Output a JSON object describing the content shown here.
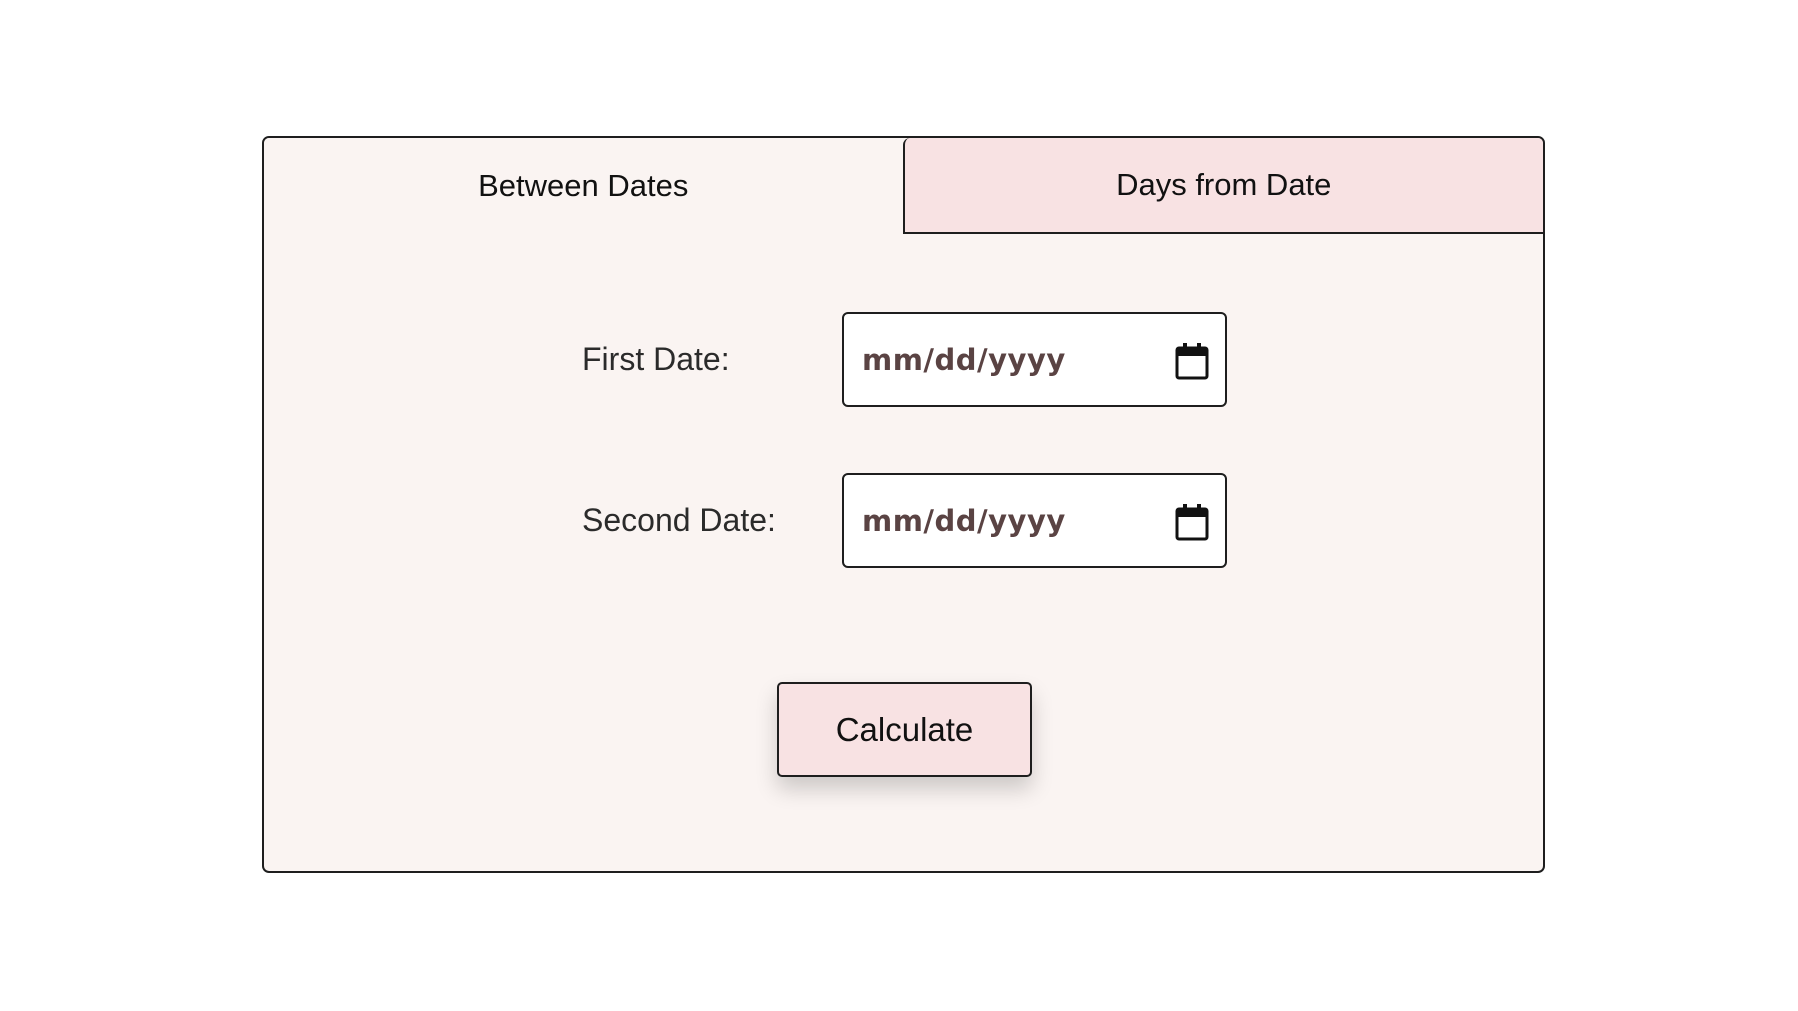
{
  "tabs": [
    {
      "label": "Between Dates",
      "active": true
    },
    {
      "label": "Days from Date",
      "active": false
    }
  ],
  "form": {
    "first_date": {
      "label": "First Date:",
      "placeholder": "mm/dd/yyyy",
      "icon": "calendar-icon"
    },
    "second_date": {
      "label": "Second Date:",
      "placeholder": "mm/dd/yyyy",
      "icon": "calendar-icon"
    }
  },
  "actions": {
    "calculate_label": "Calculate"
  },
  "colors": {
    "panel_bg": "#faf4f2",
    "inactive_tab_bg": "#f8e2e3",
    "button_bg": "#f8e2e3",
    "border": "#1e1e1e",
    "placeholder_text": "#5a4343"
  }
}
